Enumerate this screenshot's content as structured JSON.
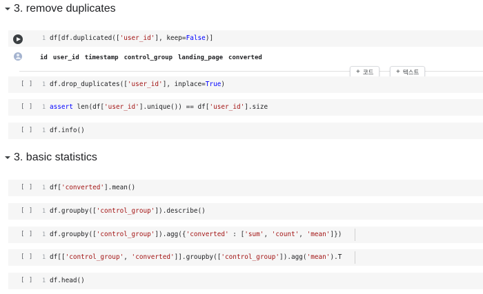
{
  "sections": [
    {
      "title": "3. remove duplicates"
    },
    {
      "title": "3. basic statistics"
    }
  ],
  "cells": [
    {
      "prompt": "",
      "lineno": "1",
      "code": [
        [
          "n",
          "df[df.duplicated(["
        ],
        [
          "s",
          "'user_id'"
        ],
        [
          "n",
          "], keep="
        ],
        [
          "kw",
          "False"
        ],
        [
          "n",
          ")]"
        ]
      ]
    },
    {
      "prompt": "[ ]",
      "lineno": "1",
      "code": [
        [
          "n",
          "df.drop_duplicates(["
        ],
        [
          "s",
          "'user_id'"
        ],
        [
          "n",
          "], inplace="
        ],
        [
          "kw",
          "True"
        ],
        [
          "n",
          ")"
        ]
      ]
    },
    {
      "prompt": "[ ]",
      "lineno": "1",
      "code": [
        [
          "kw",
          "assert"
        ],
        [
          "n",
          " len(df["
        ],
        [
          "s",
          "'user_id'"
        ],
        [
          "n",
          "].unique()) == df["
        ],
        [
          "s",
          "'user_id'"
        ],
        [
          "n",
          "].size"
        ]
      ]
    },
    {
      "prompt": "[ ]",
      "lineno": "1",
      "code": [
        [
          "n",
          "df.info()"
        ]
      ]
    },
    {
      "prompt": "[ ]",
      "lineno": "1",
      "code": [
        [
          "n",
          "df["
        ],
        [
          "s",
          "'converted'"
        ],
        [
          "n",
          "].mean()"
        ]
      ]
    },
    {
      "prompt": "[ ]",
      "lineno": "1",
      "code": [
        [
          "n",
          "df.groupby(["
        ],
        [
          "s",
          "'control_group'"
        ],
        [
          "n",
          "]).describe()"
        ]
      ]
    },
    {
      "prompt": "[ ]",
      "lineno": "1",
      "code": [
        [
          "n",
          "df.groupby(["
        ],
        [
          "s",
          "'control_group'"
        ],
        [
          "n",
          "]).agg({"
        ],
        [
          "s",
          "'converted'"
        ],
        [
          "n",
          " : ["
        ],
        [
          "s",
          "'sum'"
        ],
        [
          "n",
          ", "
        ],
        [
          "s",
          "'count'"
        ],
        [
          "n",
          ", "
        ],
        [
          "s",
          "'mean'"
        ],
        [
          "n",
          "]})"
        ]
      ]
    },
    {
      "prompt": "[ ]",
      "lineno": "1",
      "code": [
        [
          "n",
          "df[["
        ],
        [
          "s",
          "'control_group'"
        ],
        [
          "n",
          ", "
        ],
        [
          "s",
          "'converted'"
        ],
        [
          "n",
          "]].groupby(["
        ],
        [
          "s",
          "'control_group'"
        ],
        [
          "n",
          "]).agg("
        ],
        [
          "s",
          "'mean'"
        ],
        [
          "n",
          ").T"
        ]
      ]
    },
    {
      "prompt": "[ ]",
      "lineno": "1",
      "code": [
        [
          "n",
          "df.head()"
        ]
      ]
    }
  ],
  "output_table": {
    "columns": [
      "id",
      "user_id",
      "timestamp",
      "control_group",
      "landing_page",
      "converted"
    ]
  },
  "toolbar": {
    "add_code_label": "코드",
    "add_text_label": "텍스트"
  },
  "icons": {
    "collapse": "caret-down-icon",
    "run": "run-cell-icon",
    "output": "output-avatar-icon",
    "add": "plus-icon"
  }
}
